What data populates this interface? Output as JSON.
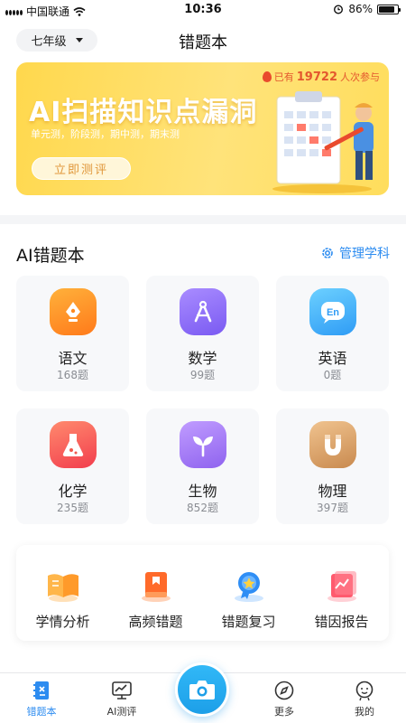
{
  "status_bar": {
    "carrier": "中国联通",
    "time": "10:36",
    "battery": "86%",
    "battery_level": 0.86
  },
  "header": {
    "grade": "七年级",
    "title": "错题本"
  },
  "banner": {
    "participants_prefix": "已有",
    "participants_count": "19722",
    "participants_suffix": "人次参与",
    "headline": "AI扫描知识点漏洞",
    "subline": "单元测，阶段测，期中测，期末测",
    "cta": "立即测评"
  },
  "section": {
    "title": "AI错题本",
    "manage": "管理学科"
  },
  "subjects": [
    {
      "name": "语文",
      "count": "168题",
      "icon": "pen-nib-icon",
      "color": "#ff8a1f"
    },
    {
      "name": "数学",
      "count": "99题",
      "icon": "compass-icon",
      "color": "#8c6cf5"
    },
    {
      "name": "英语",
      "count": "0题",
      "icon": "en-bubble-icon",
      "color": "#3fb0f8"
    },
    {
      "name": "化学",
      "count": "235题",
      "icon": "flask-icon",
      "color": "#ff5a4c"
    },
    {
      "name": "生物",
      "count": "852题",
      "icon": "sprout-icon",
      "color": "#a87cf3"
    },
    {
      "name": "物理",
      "count": "397题",
      "icon": "magnet-icon",
      "color": "#d9a46a"
    }
  ],
  "tools": [
    {
      "label": "学情分析",
      "icon": "open-book-icon"
    },
    {
      "label": "高频错题",
      "icon": "bookmark-book-icon"
    },
    {
      "label": "错题复习",
      "icon": "badge-star-icon"
    },
    {
      "label": "错因报告",
      "icon": "chart-report-icon"
    }
  ],
  "tabs": [
    {
      "label": "错题本",
      "icon": "notebook-icon",
      "active": true
    },
    {
      "label": "AI测评",
      "icon": "monitor-chart-icon",
      "active": false
    },
    {
      "label": "更多",
      "icon": "compass-nav-icon",
      "active": false
    },
    {
      "label": "我的",
      "icon": "profile-icon",
      "active": false
    }
  ]
}
